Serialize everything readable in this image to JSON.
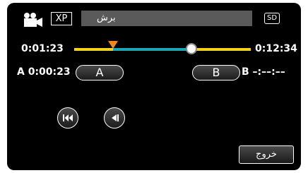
{
  "header": {
    "icons": [
      "video-camera-icon"
    ],
    "quality_badge": "XP",
    "title": "برش",
    "media_badge": "SD"
  },
  "timeline": {
    "start_time": "0:01:23",
    "end_time": "0:12:34",
    "colors": {
      "track": "#f2d21f",
      "selection": "#1aa6b5",
      "marker": "#f28a1a"
    }
  },
  "ab_controls": {
    "a_label": "A",
    "a_time": "A  0:00:23",
    "b_label": "B",
    "b_time": "B  –:––:––"
  },
  "playback": {
    "icons": [
      "skip-to-start-icon",
      "frame-step-back-icon"
    ]
  },
  "footer": {
    "exit_label": "خروج"
  }
}
